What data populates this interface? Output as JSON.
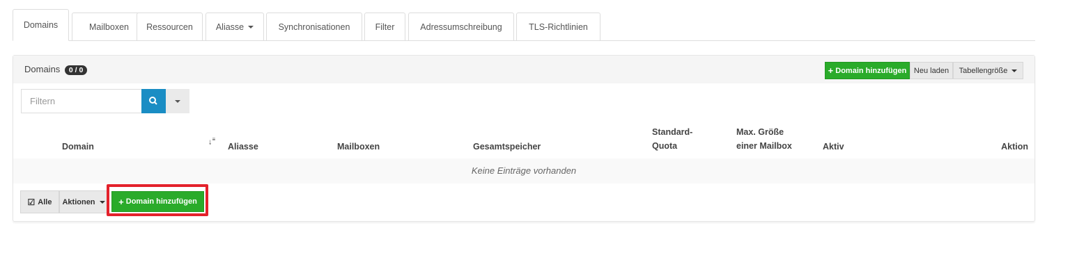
{
  "tabs": [
    {
      "label": "Domains",
      "active": true
    },
    {
      "label": "Mailboxen"
    },
    {
      "label": "Ressourcen"
    },
    {
      "label": "Aliasse"
    },
    {
      "label": "Synchronisationen"
    },
    {
      "label": "Filter"
    },
    {
      "label": "Adressumschreibung"
    },
    {
      "label": "TLS-Richtlinien"
    }
  ],
  "panel": {
    "title": "Domains",
    "count_badge": "0 / 0",
    "add_domain_label": "Domain hinzufügen",
    "reload_label": "Neu laden",
    "table_size_label": "Tabellengröße"
  },
  "filter": {
    "placeholder": "Filtern"
  },
  "table": {
    "columns": [
      "Domain",
      "Aliasse",
      "Mailboxen",
      "Gesamtspeicher",
      "Standard-",
      "Quota",
      "Max. Größe",
      "einer Mailbox",
      "Aktiv",
      "Aktion"
    ],
    "empty_text": "Keine Einträge vorhanden"
  },
  "footer": {
    "all_label": "Alle",
    "actions_label": "Aktionen",
    "add_domain_label": "Domain hinzufügen"
  },
  "colors": {
    "accent_green": "#2aab2a",
    "search_blue": "#1a8dc4",
    "highlight_red": "#e3212b"
  }
}
